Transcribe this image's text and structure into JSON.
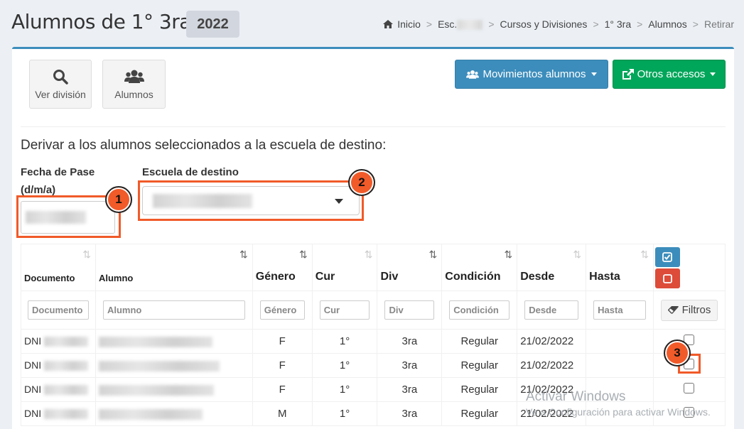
{
  "page": {
    "title": "Alumnos de 1° 3ra -",
    "year_badge": "2022"
  },
  "breadcrumb": {
    "items": [
      "Inicio",
      "Esc.",
      "Cursos y Divisiones",
      "1° 3ra",
      "Alumnos",
      "Retirar"
    ],
    "separator": ">"
  },
  "toolbar": {
    "ver_division": "Ver división",
    "alumnos": "Alumnos",
    "movimientos": "Movimientos alumnos",
    "otros_accesos": "Otros accesos"
  },
  "form": {
    "heading": "Derivar a los alumnos seleccionados a la escuela de destino:",
    "fecha_label_1": "Fecha de Pase",
    "fecha_label_2": "(d/m/a)",
    "escuela_label": "Escuela de destino"
  },
  "markers": [
    "1",
    "2",
    "3"
  ],
  "table": {
    "headers": [
      "Documento",
      "Alumno",
      "Género",
      "Cur",
      "Div",
      "Condición",
      "Desde",
      "Hasta"
    ],
    "filter_placeholders": [
      "Documento",
      "Alumno",
      "Género",
      "Cur",
      "Div",
      "Condición",
      "Desde",
      "Hasta"
    ],
    "filtros_button": "Filtros",
    "rows": [
      {
        "doc": "DNI",
        "genero": "F",
        "cur": "1°",
        "div": "3ra",
        "condicion": "Regular",
        "desde": "21/02/2022",
        "hasta": ""
      },
      {
        "doc": "DNI",
        "genero": "F",
        "cur": "1°",
        "div": "3ra",
        "condicion": "Regular",
        "desde": "21/02/2022",
        "hasta": ""
      },
      {
        "doc": "DNI",
        "genero": "F",
        "cur": "1°",
        "div": "3ra",
        "condicion": "Regular",
        "desde": "21/02/2022",
        "hasta": ""
      },
      {
        "doc": "DNI",
        "genero": "M",
        "cur": "1°",
        "div": "3ra",
        "condicion": "Regular",
        "desde": "21/02/2022",
        "hasta": ""
      }
    ]
  },
  "watermark": {
    "line1": "Activar Windows",
    "line2": "Ve a Configuración para activar Windows."
  },
  "colors": {
    "primary": "#3c8dbc",
    "success": "#00a65a",
    "danger": "#dd4b39",
    "annotation": "#f15a29"
  }
}
